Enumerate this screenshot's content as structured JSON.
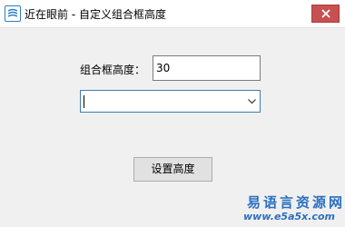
{
  "window": {
    "title": "近在眼前 - 自定义组合框高度",
    "app_icon": "app-logo-icon",
    "close_icon": "close-icon",
    "accent_color": "#c75050"
  },
  "form": {
    "height_label": "组合框高度：",
    "height_value": "30",
    "combo_value": "",
    "combo_icon": "chevron-down-icon",
    "set_button_label": "设置高度"
  },
  "watermark": {
    "logo_text": "易语言资源网",
    "url": "www.e5a5x.com"
  }
}
